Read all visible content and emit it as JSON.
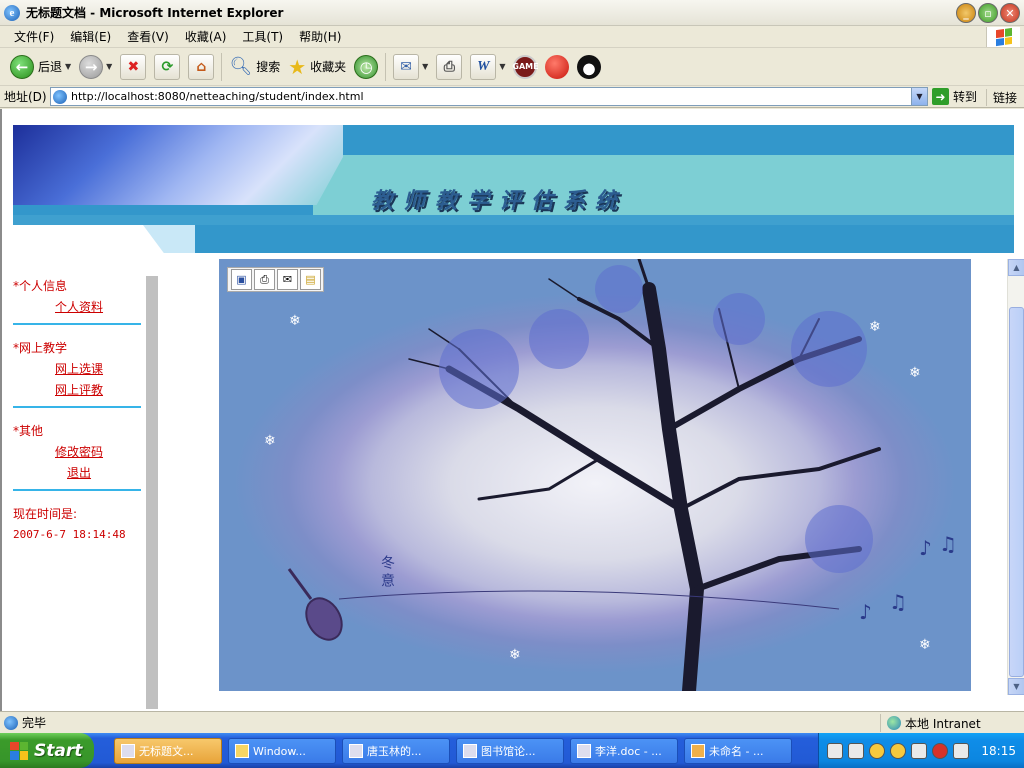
{
  "window": {
    "title": "无标题文档 - Microsoft Internet Explorer"
  },
  "menu": [
    "文件(F)",
    "编辑(E)",
    "查看(V)",
    "收藏(A)",
    "工具(T)",
    "帮助(H)"
  ],
  "toolbar": {
    "back_label": "后退",
    "search_label": "搜索",
    "favorites_label": "收藏夹"
  },
  "address": {
    "label": "地址(D)",
    "url": "http://localhost:8080/netteaching/student/index.html",
    "goto_label": "转到",
    "links_label": "链接"
  },
  "banner": {
    "title": "教师教学评估系统"
  },
  "sidebar": {
    "sections": [
      {
        "heading": "*个人信息",
        "links": [
          "个人资料"
        ]
      },
      {
        "heading": "*网上教学",
        "links": [
          "网上选课",
          "网上评教"
        ]
      },
      {
        "heading": "*其他",
        "links": [
          "修改密码",
          "退出"
        ]
      }
    ],
    "time_label": "现在时间是:",
    "time_value": "2007-6-7 18:14:48"
  },
  "picture": {
    "vertical_text": "冬意"
  },
  "status": {
    "text": "完毕",
    "zone": "本地 Intranet"
  },
  "taskbar": {
    "start_label": "Start",
    "tasks": [
      "无标题文...",
      "Window...",
      "唐玉林的...",
      "图书馆论...",
      "李洋.doc - ...",
      "未命名 - ..."
    ],
    "clock": "18:15"
  },
  "colors": {
    "link_red": "#cc0000",
    "divider_blue": "#36b4e8",
    "banner_blue": "#3397cb",
    "banner_teal": "#7dcfd4"
  }
}
